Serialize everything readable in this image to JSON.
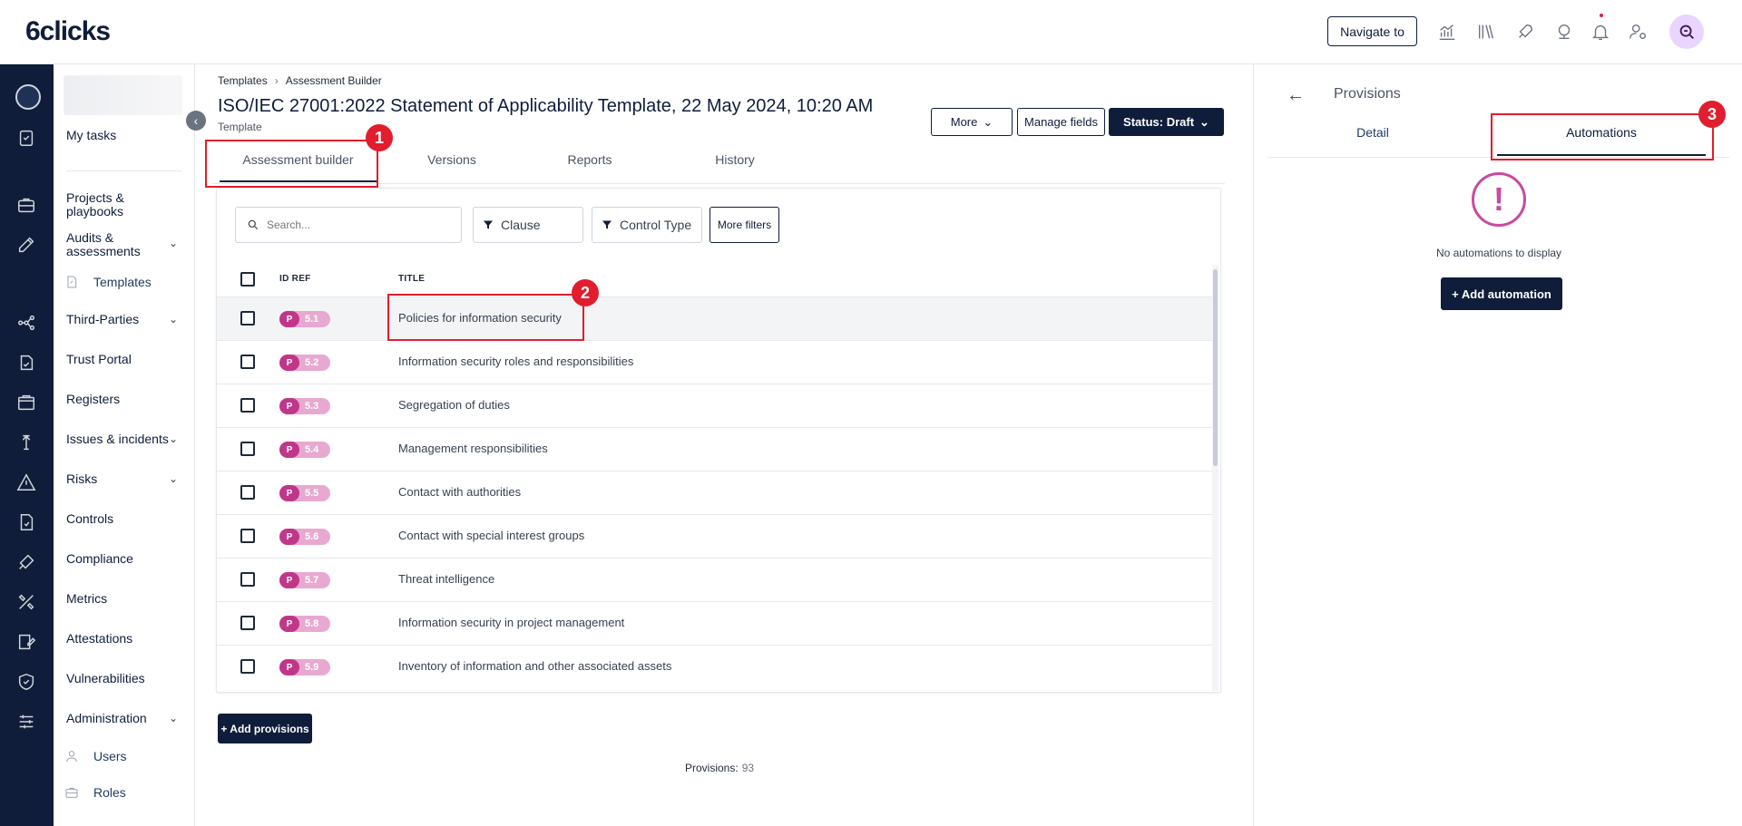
{
  "app": {
    "logo": "6clicks"
  },
  "topbar": {
    "navigate_label": "Navigate to"
  },
  "sidebar": {
    "my_tasks": "My tasks",
    "projects": "Projects & playbooks",
    "audits": "Audits & assessments",
    "templates": "Templates",
    "third_parties": "Third-Parties",
    "trust_portal": "Trust Portal",
    "registers": "Registers",
    "issues": "Issues & incidents",
    "risks": "Risks",
    "controls": "Controls",
    "compliance": "Compliance",
    "metrics": "Metrics",
    "attestations": "Attestations",
    "vulnerabilities": "Vulnerabilities",
    "administration": "Administration",
    "users": "Users",
    "roles": "Roles"
  },
  "breadcrumb": {
    "item1": "Templates",
    "item2": "Assessment Builder"
  },
  "page": {
    "title": "ISO/IEC 27001:2022 Statement of Applicability Template, 22 May 2024, 10:20 AM",
    "subtitle": "Template"
  },
  "actions": {
    "more": "More",
    "manage_fields": "Manage fields",
    "status": "Status: Draft"
  },
  "tabs": [
    "Assessment builder",
    "Versions",
    "Reports",
    "History"
  ],
  "filters": {
    "search_placeholder": "Search...",
    "clause": "Clause",
    "control_type": "Control Type",
    "more_filters": "More filters"
  },
  "table": {
    "col_id": "ID REF",
    "col_title": "TITLE",
    "rows": [
      {
        "badge": "P",
        "id": "5.1",
        "title": "Policies for information security"
      },
      {
        "badge": "P",
        "id": "5.2",
        "title": "Information security roles and responsibilities"
      },
      {
        "badge": "P",
        "id": "5.3",
        "title": "Segregation of duties"
      },
      {
        "badge": "P",
        "id": "5.4",
        "title": "Management responsibilities"
      },
      {
        "badge": "P",
        "id": "5.5",
        "title": "Contact with authorities"
      },
      {
        "badge": "P",
        "id": "5.6",
        "title": "Contact with special interest groups"
      },
      {
        "badge": "P",
        "id": "5.7",
        "title": "Threat intelligence"
      },
      {
        "badge": "P",
        "id": "5.8",
        "title": "Information security in project management"
      },
      {
        "badge": "P",
        "id": "5.9",
        "title": "Inventory of information and other associated assets"
      }
    ]
  },
  "footer": {
    "add_provisions": "+ Add provisions",
    "provisions_label": "Provisions:",
    "provisions_count": "93"
  },
  "right_panel": {
    "title": "Provisions",
    "tab_detail": "Detail",
    "tab_automations": "Automations",
    "empty_icon": "!",
    "empty_text": "No automations to display",
    "add_automation": "+ Add automation"
  },
  "annotations": {
    "one": "1",
    "two": "2",
    "three": "3"
  },
  "colors": {
    "navy": "#0f1d3a",
    "badge_pink": "#c0378a",
    "annotation_red": "#e11d2e"
  }
}
